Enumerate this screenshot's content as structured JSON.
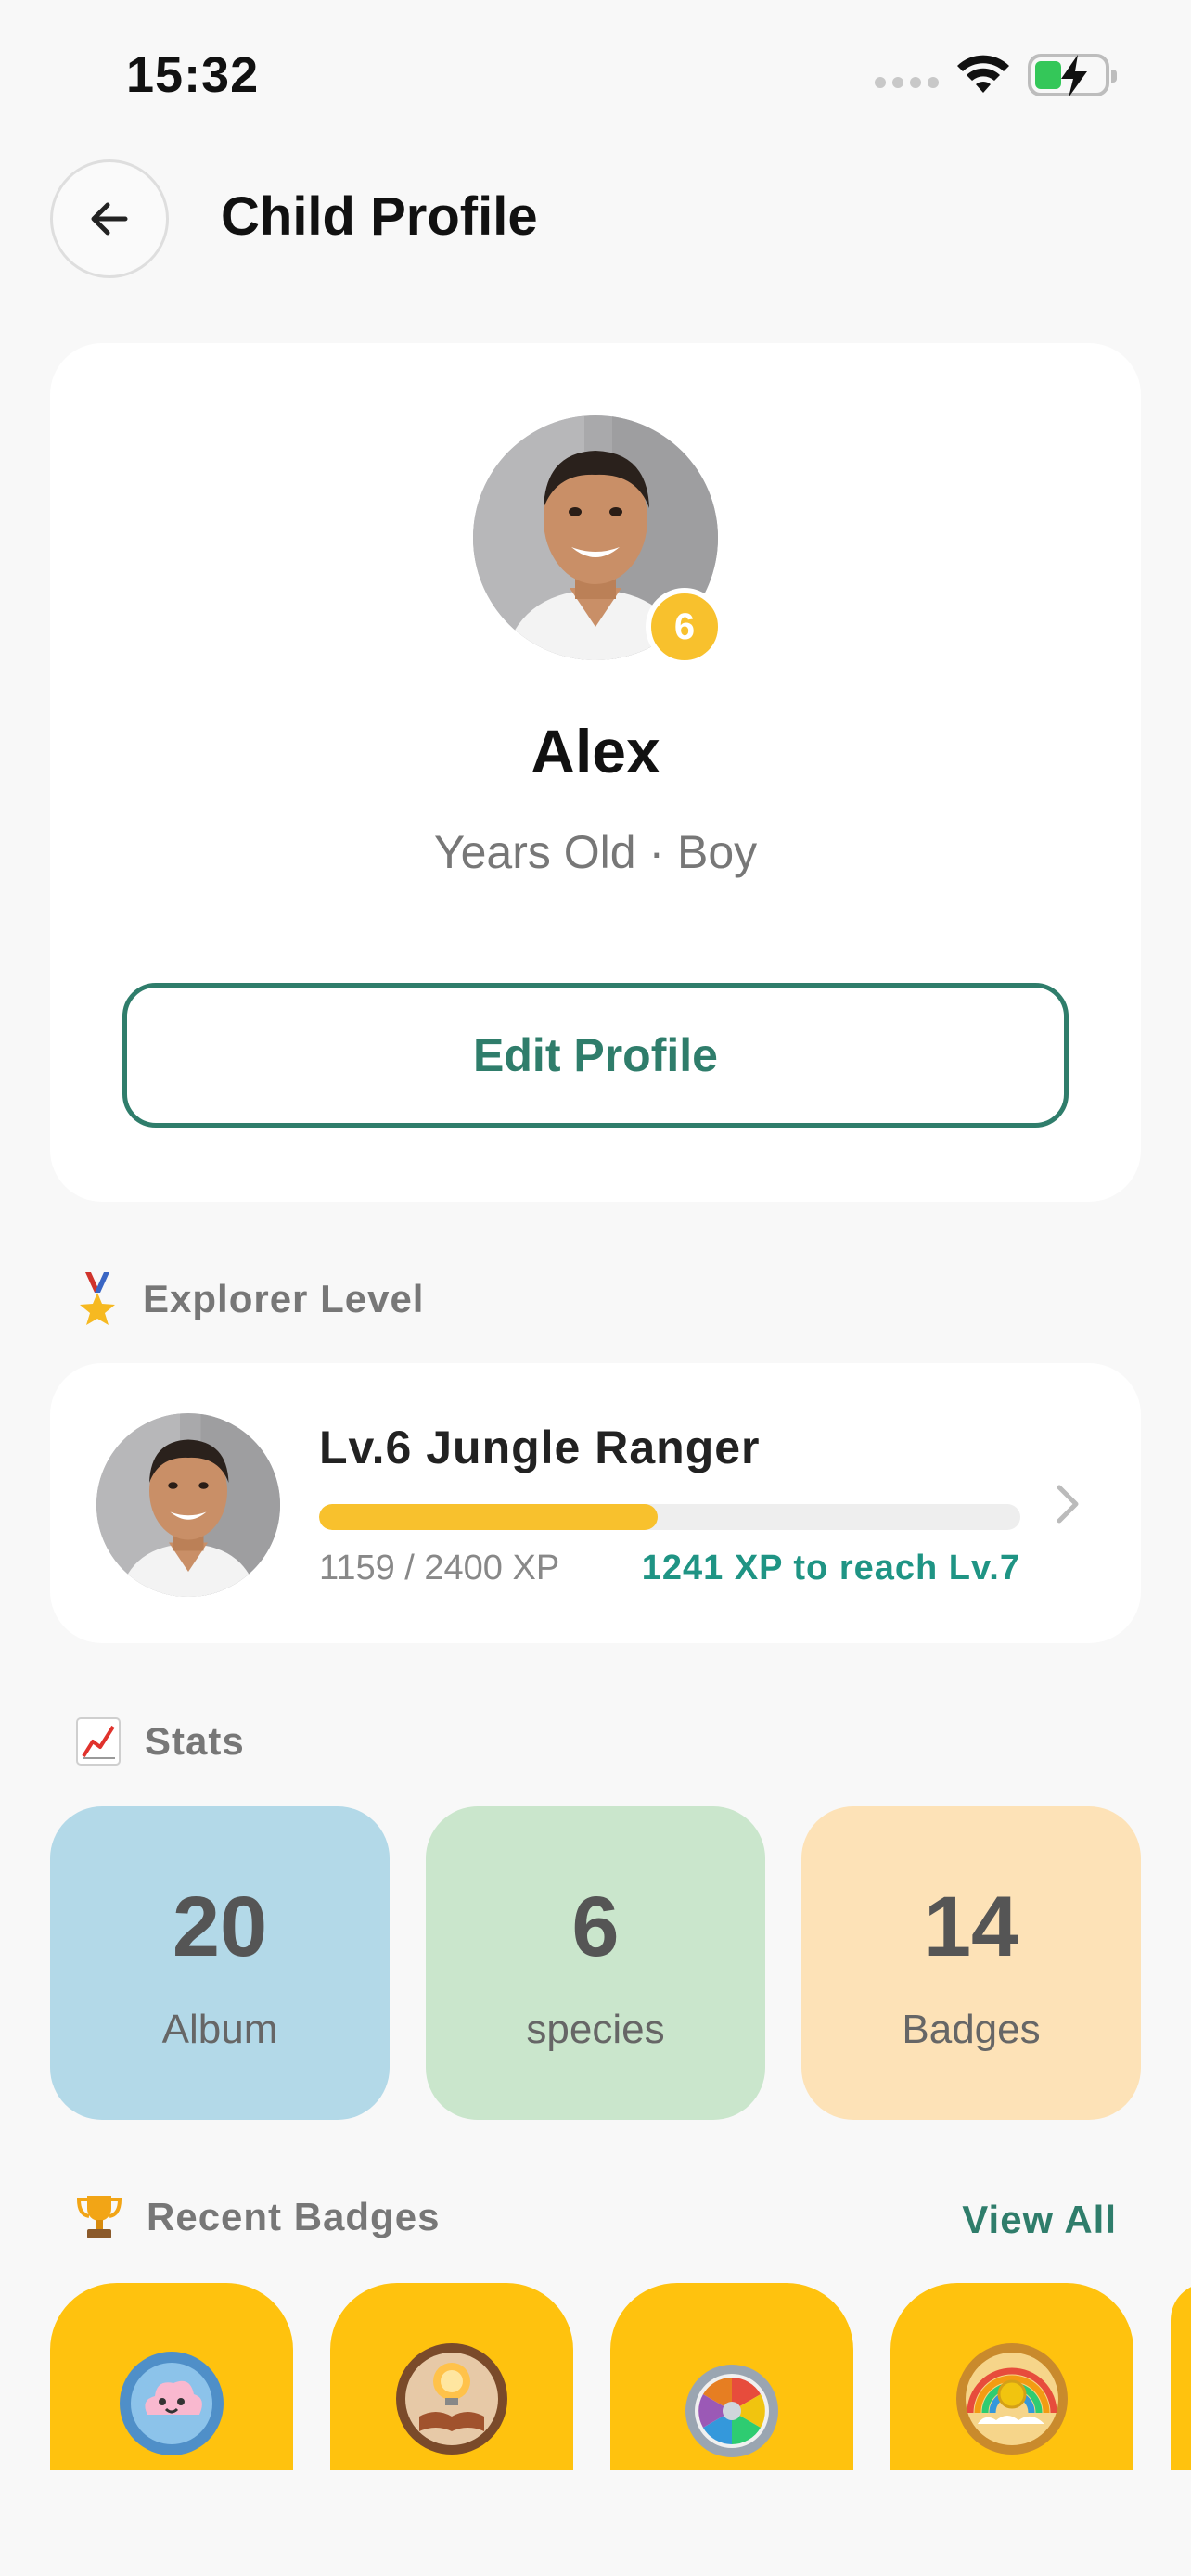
{
  "status_bar": {
    "time": "15:32"
  },
  "header": {
    "title": "Child Profile"
  },
  "profile": {
    "name": "Alex",
    "age_badge": "6",
    "meta": "Years Old · Boy",
    "edit_label": "Edit Profile"
  },
  "explorer_level": {
    "section_label": "Explorer Level",
    "section_icon": "medal-icon",
    "level_title": "Lv.6 Jungle Ranger",
    "xp_text": "1159 / 2400 XP",
    "xp_fraction": 0.483,
    "xp_remaining": "1241 XP to reach Lv.7"
  },
  "stats": {
    "section_label": "Stats",
    "section_icon": "chart-increasing-icon",
    "items": [
      {
        "value": "20",
        "label": "Album",
        "color": "#b3d9e8"
      },
      {
        "value": "6",
        "label": "species",
        "color": "#cae6cc"
      },
      {
        "value": "14",
        "label": "Badges",
        "color": "#fde2b7"
      }
    ]
  },
  "recent_badges": {
    "section_label": "Recent Badges",
    "section_icon": "trophy-icon",
    "view_all": "View All",
    "badges": [
      {
        "icon": "cloud-badge-icon"
      },
      {
        "icon": "lightbulb-book-badge-icon"
      },
      {
        "icon": "color-wheel-badge-icon"
      },
      {
        "icon": "rainbow-coin-badge-icon"
      }
    ]
  },
  "colors": {
    "accent_green": "#2f7d6b",
    "teal_text": "#1f9484",
    "yellow": "#f8c12d",
    "badge_yellow": "#ffc20e",
    "background": "#f8f8f8"
  }
}
